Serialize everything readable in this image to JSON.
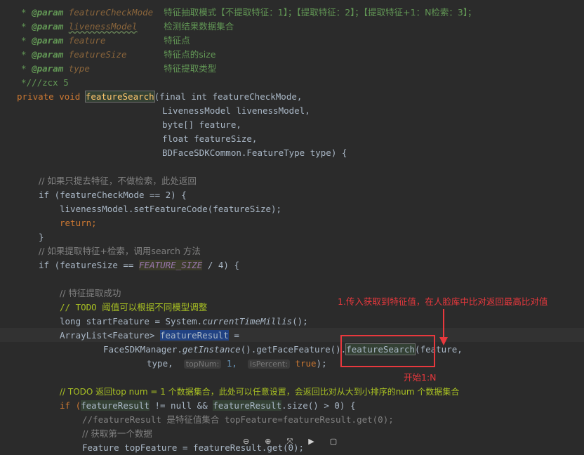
{
  "doc": {
    "param1_name": "featureCheckMode",
    "param1_desc": "特征抽取模式【不提取特征：1】；【提取特征：2】；【提取特征+1：N检索：3】；",
    "param2_name": "livenessModel",
    "param2_desc": "检测结果数据集合",
    "param3_name": "feature",
    "param3_desc": "特征点",
    "param4_name": "featureSize",
    "param4_desc": "特征点的size",
    "param5_name": "type",
    "param5_desc": "特征提取类型",
    "tag": "@param",
    "end": "*///zcx 5"
  },
  "code": {
    "private_void": "private void ",
    "method_name": "featureSearch",
    "sig1": "(final int featureCheckMode,",
    "sig2": "LivenessModel livenessModel,",
    "sig3": "byte[] feature,",
    "sig4": "float featureSize,",
    "sig5": "BDFaceSDKCommon.FeatureType type) {",
    "c1": "// 如果只提去特征，不做检索，此处返回",
    "if1": "if (featureCheckMode == 2) {",
    "l_set": "livenessModel.setFeatureCode(featureSize);",
    "l_ret": "return;",
    "l_close": "}",
    "c2": "// 如果提取特征+检索，调用search 方法",
    "if2_a": "if (featureSize == ",
    "if2_const": "FEATURE_SIZE",
    "if2_b": " / 4) {",
    "c3": "// 特征提取成功",
    "todo1": "// TODO 阈值可以根据不同模型调整",
    "l_long_a": "long startFeature = System.",
    "l_long_fn": "currentTimeMillis",
    "l_long_b": "();",
    "l_arr_a": "ArrayList<Feature> ",
    "l_arr_var": "featureResult",
    "l_arr_b": " =",
    "l_fsm_a": "FaceSDKManager.",
    "l_fsm_inst": "getInstance",
    "l_fsm_b": "().getFaceFeature().",
    "l_fsm_fn": "featureSearch",
    "l_fsm_c": "(feature,",
    "l_type": "type,",
    "hint_top": "topNum:",
    "val_top": "1,",
    "hint_is": "isPercent:",
    "val_true": "true",
    "l_type_end": ");",
    "todo2": "// TODO 返回top num = 1 个数据集合，此处可以任意设置，会返回比对从大到小排序的num 个数据集合",
    "if3_a": "if (",
    "if3_var": "featureResult",
    "if3_b": " != null && ",
    "if3_var2": "featureResult",
    "if3_c": ".size() > 0) {",
    "c4": "//featureResult 是特征值集合 topFeature=featureResult.get(0);",
    "c5": "// 获取第一个数据",
    "l_last": "Feature topFeature = featureResult.get(0);"
  },
  "annotations": {
    "note1": "1.传入获取到特征值，在人脸库中比对返回最高比对值",
    "note2": "开始1:N"
  },
  "toolbar": {
    "zoom_out": "⊖",
    "zoom_in": "⊕",
    "fit": "⤧",
    "play": "▶",
    "more": "▢"
  },
  "colors": {
    "background": "#2b2b2b",
    "annotation_red": "#e8383d"
  }
}
